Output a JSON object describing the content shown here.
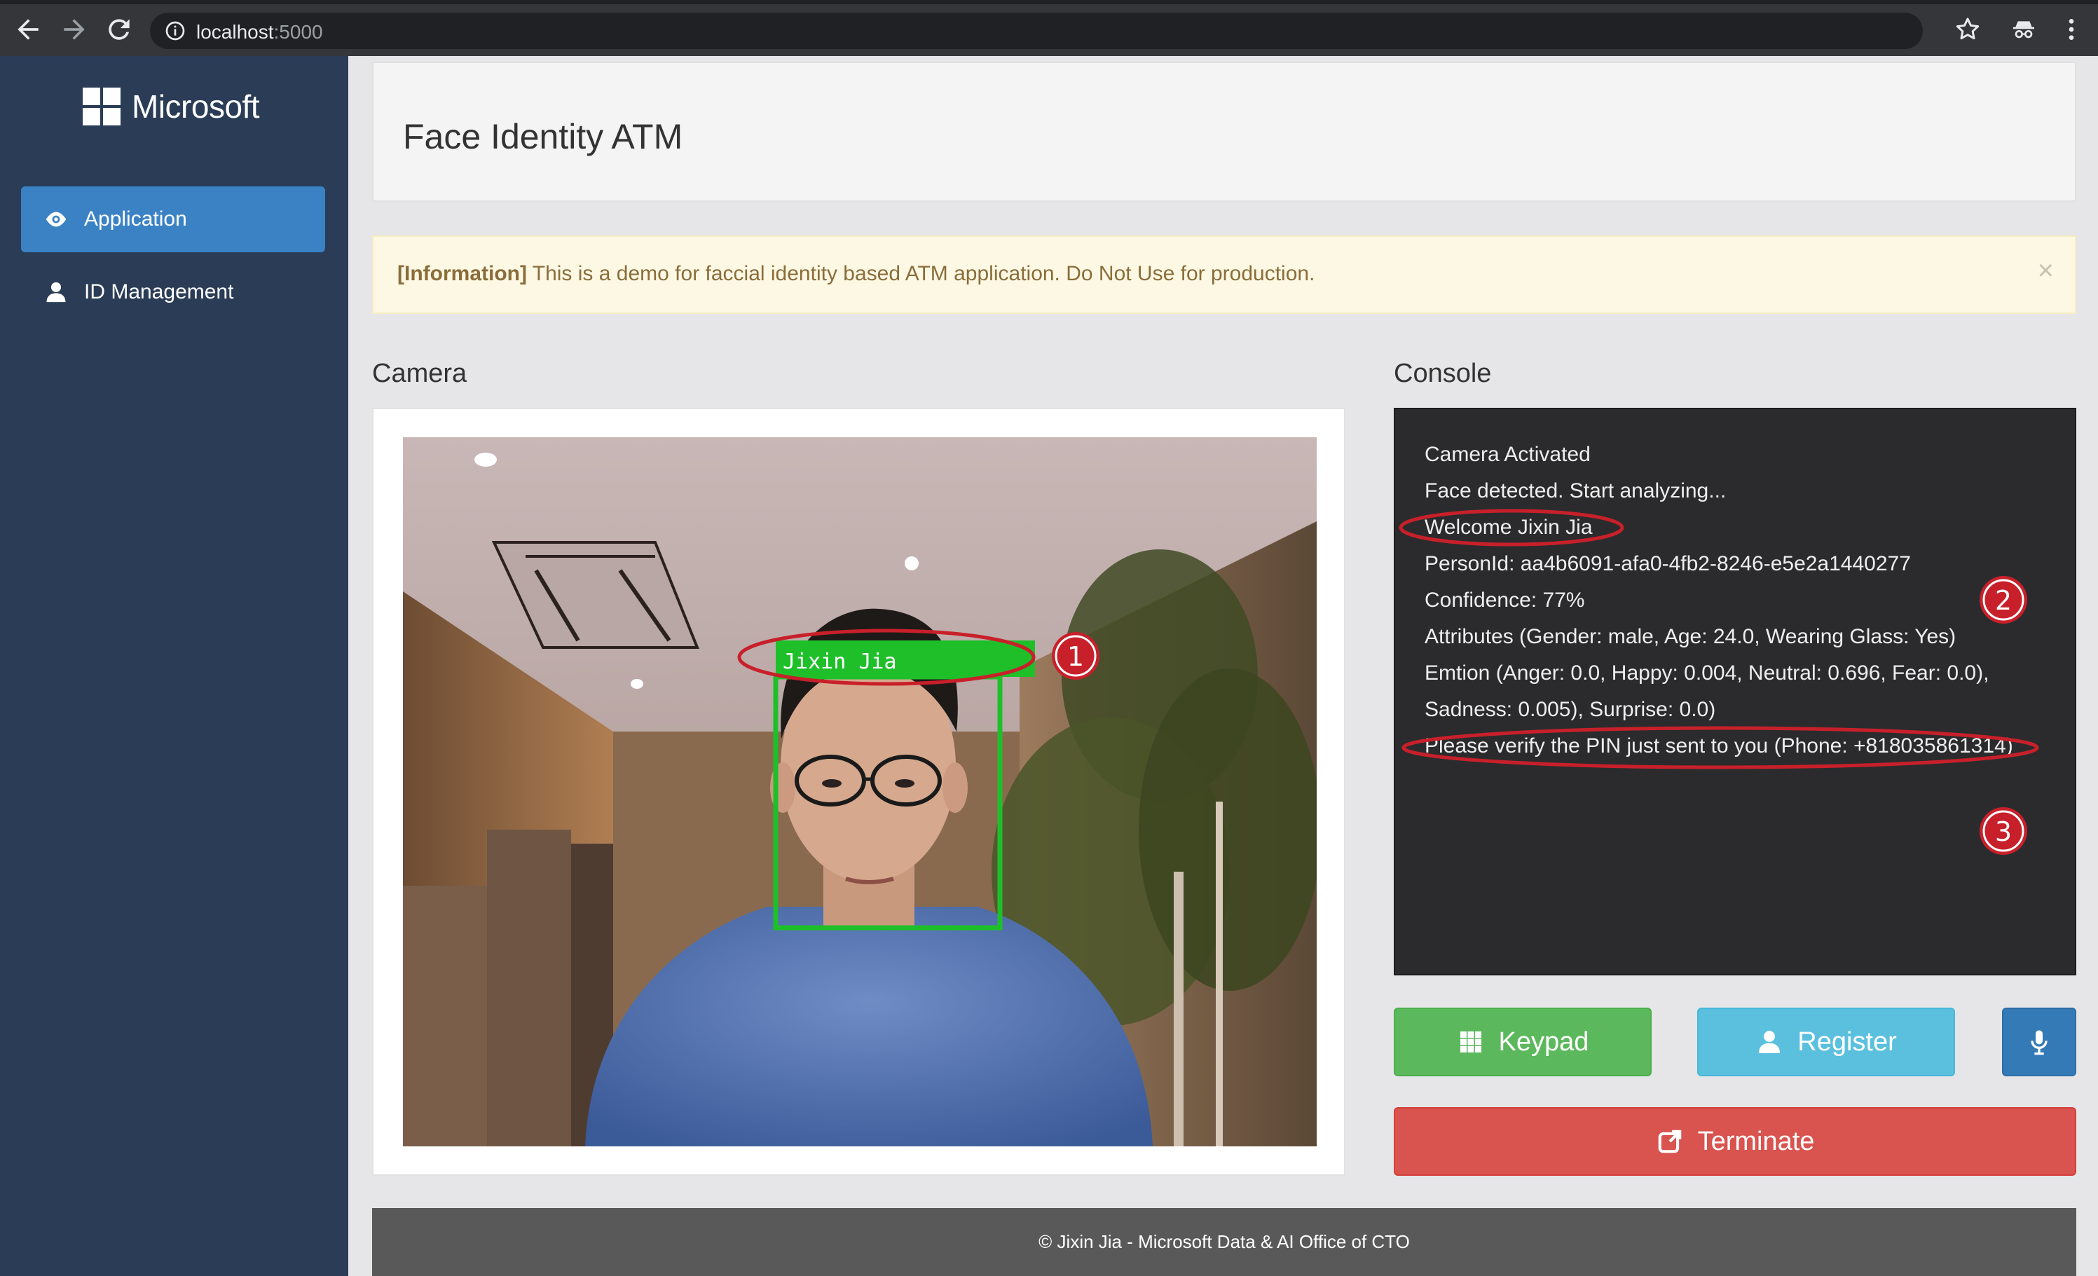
{
  "browser": {
    "url_host": "localhost",
    "url_port": ":5000",
    "icons": [
      "back-icon",
      "forward-icon",
      "reload-icon",
      "info-icon",
      "star-icon",
      "incognito-icon",
      "kebab-menu-icon"
    ]
  },
  "sidebar": {
    "logo_text": "Microsoft",
    "items": [
      {
        "label": "Application",
        "icon": "eye-icon",
        "active": true
      },
      {
        "label": "ID Management",
        "icon": "user-icon",
        "active": false
      }
    ]
  },
  "header": {
    "title": "Face Identity ATM"
  },
  "alert": {
    "tag": "[Information]",
    "message": " This is a demo for faccial identity based ATM application. Do Not Use for production.",
    "close": "×"
  },
  "camera": {
    "title": "Camera",
    "face_label": "Jixin Jia",
    "callout_1": "1"
  },
  "console": {
    "title": "Console",
    "lines": [
      "Camera Activated",
      "Face detected. Start analyzing...",
      "Welcome Jixin Jia",
      "PersonId: aa4b6091-afa0-4fb2-8246-e5e2a1440277",
      "Confidence: 77%",
      "Attributes (Gender: male, Age: 24.0, Wearing Glass: Yes)",
      "Emtion (Anger: 0.0, Happy: 0.004, Neutral: 0.696, Fear: 0.0),",
      "Sadness: 0.005), Surprise: 0.0)",
      "Please verify the PIN just sent to you  (Phone: +818035861314)"
    ],
    "callout_2": "2",
    "callout_3": "3"
  },
  "buttons": {
    "keypad": "Keypad",
    "register": "Register",
    "terminate": "Terminate"
  },
  "colors": {
    "sidebar": "#2a3c56",
    "active_item": "#3a82c4",
    "keypad": "#5cb85c",
    "register": "#5bc0de",
    "mic": "#337ab7",
    "terminate": "#d9534f",
    "annotation_red": "#c8202a",
    "face_box_green": "#1fbf2a"
  },
  "footer": {
    "text": "© Jixin Jia - Microsoft Data & AI Office of CTO"
  }
}
